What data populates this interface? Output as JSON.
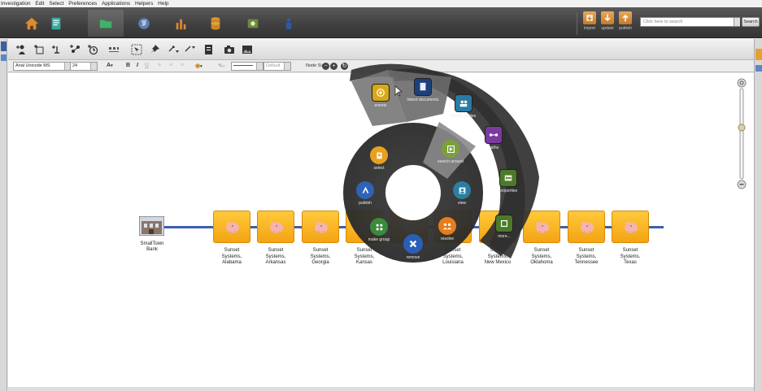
{
  "menu": [
    "Investigation",
    "Edit",
    "Select",
    "Preferences",
    "Applications",
    "Helpers",
    "Help"
  ],
  "nav": {
    "icons": [
      "home-icon",
      "book-icon",
      "folder-icon",
      "globe-icon",
      "bar-chart-icon",
      "database-icon",
      "image-icon",
      "person-icon"
    ],
    "active_index": 2
  },
  "actions": {
    "import_label": "import",
    "update_label": "update",
    "publish_label": "publish"
  },
  "search": {
    "placeholder": "Click here to search",
    "button_label": "Search"
  },
  "format": {
    "font_family": "Arial Unicode MS",
    "font_size": "24",
    "line_default": "Default",
    "node_size_label": "Node Size:"
  },
  "graph": {
    "bank": {
      "label": "SmallTown\nBank"
    },
    "nodes": [
      "Sunset\nSystems,\nAlabama",
      "Sunset\nSystems,\nArkansas",
      "Sunset\nSystems,\nGeorgia",
      "Sunset\nSystems,\nKansas",
      "",
      "Sunset\nSystems,\nLouisiana",
      "Sunset\nSystems,\nNew Mexico",
      "Sunset\nSystems,\nOklahoma",
      "Sunset\nSystems,\nTennessee",
      "Sunset\nSystems,\nTexas"
    ]
  },
  "radial_menu": {
    "inner": [
      "select",
      "publish",
      "make group",
      "remove",
      "resolve",
      "view",
      "search around"
    ],
    "outer": [
      "events",
      "linked documents",
      "linked entities",
      "paths",
      "properties",
      "more..."
    ]
  },
  "colors": {
    "node": "#f3a414",
    "edge": "#3b5fb0",
    "topbar": "#444444"
  }
}
